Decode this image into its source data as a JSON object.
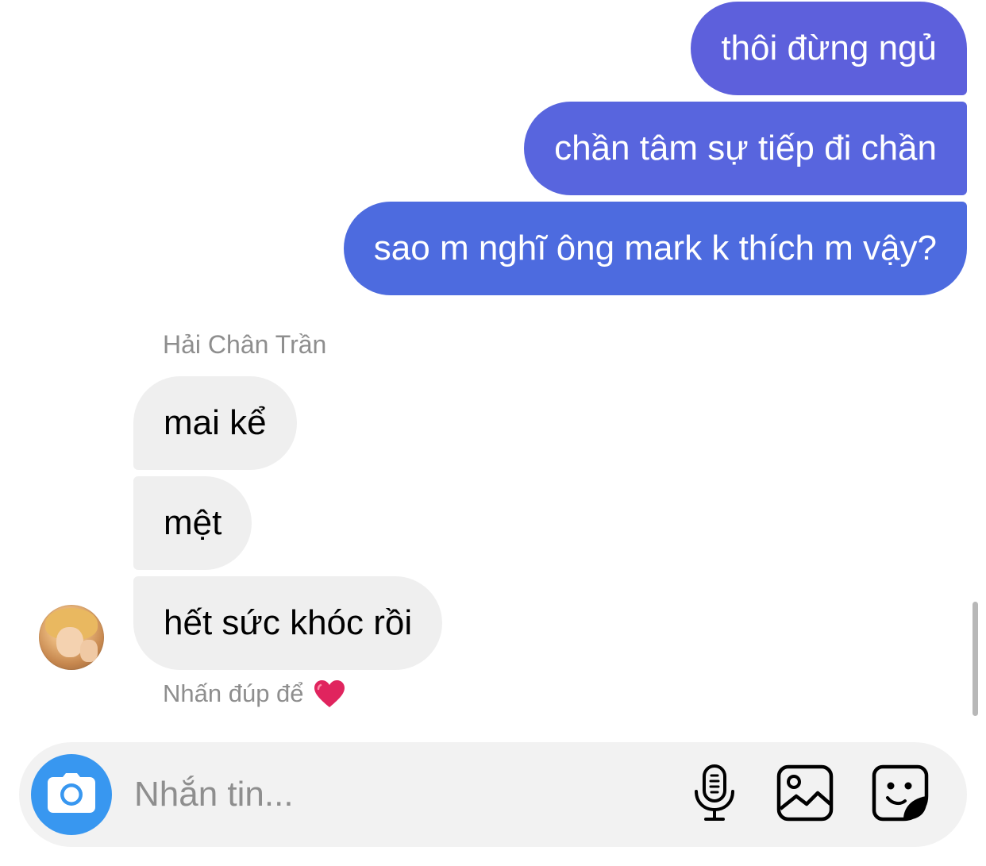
{
  "conversation": {
    "outgoing": [
      {
        "text": "thôi đừng ngủ"
      },
      {
        "text": "chần tâm sự tiếp đi chần"
      },
      {
        "text": "sao m nghĩ ông mark k thích m vậy?"
      }
    ],
    "sender_name": "Hải Chân Trần",
    "incoming": [
      {
        "text": "mai kể"
      },
      {
        "text": "mệt"
      },
      {
        "text": "hết sức khóc rồi"
      }
    ],
    "react_hint": "Nhấn đúp để",
    "react_icon": "red-heart-icon"
  },
  "composer": {
    "placeholder": "Nhắn tin...",
    "value": "",
    "icons": {
      "camera": "camera-icon",
      "mic": "microphone-icon",
      "gallery": "image-gallery-icon",
      "sticker": "sticker-icon"
    }
  },
  "colors": {
    "outgoing_bubble_top": "#5d60dc",
    "outgoing_bubble_bottom": "#4d6bdf",
    "incoming_bubble": "#efefef",
    "camera_button": "#3897f0",
    "secondary_text": "#8e8e8e",
    "heart": "#e0245e"
  }
}
